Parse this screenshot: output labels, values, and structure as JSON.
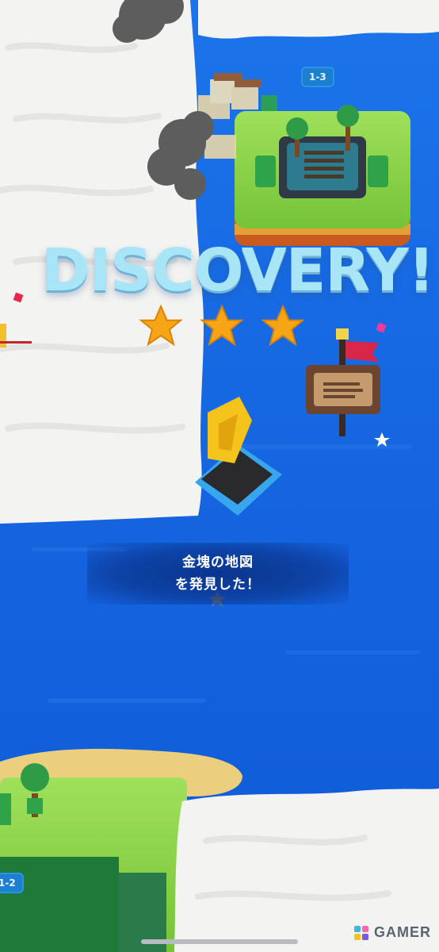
{
  "discovery_title": "DISCOVERY!",
  "stars_earned": 3,
  "discovery_message": {
    "line1": "金塊の地図",
    "line2": "を発見した！"
  },
  "stage_labels": {
    "top_island": "1-3",
    "bottom_island": "1-2"
  },
  "watermark": "GAMER",
  "colors": {
    "ocean": "#1565e0",
    "fog": "#f3f3f1",
    "star": "#f6a516",
    "title": "#a8e6f7",
    "grass": "#8fd84a"
  }
}
